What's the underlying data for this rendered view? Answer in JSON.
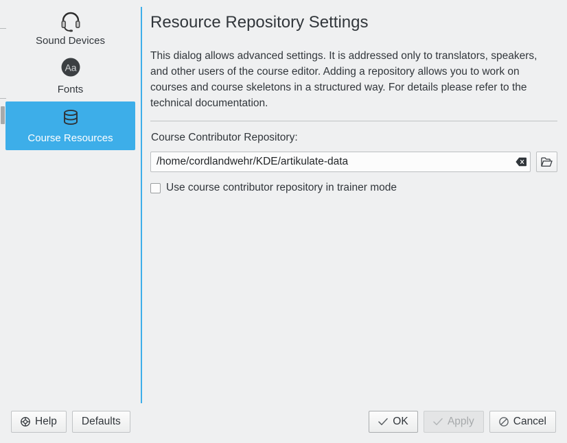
{
  "sidebar": {
    "items": [
      {
        "label": "Sound Devices",
        "icon": "headset-icon",
        "selected": false
      },
      {
        "label": "Fonts",
        "icon": "fonts-aa-icon",
        "selected": false
      },
      {
        "label": "Course Resources",
        "icon": "database-icon",
        "selected": true
      }
    ],
    "selection_color": "#3daee9",
    "divider_color": "#3daee9"
  },
  "page": {
    "title": "Resource Repository Settings",
    "description": "This dialog allows advanced settings. It is addressed only to translators, speakers, and other users of the course editor. Adding a repository allows you to work on courses and course skeletons in a structured way. For details please refer to the technical documentation.",
    "field_label": "Course Contributor Repository:",
    "path_value": "/home/cordlandwehr/KDE/artikulate-data",
    "path_placeholder": "",
    "clear_icon": "clear-text-icon",
    "browse_icon": "folder-open-icon",
    "checkbox_label": "Use course contributor repository in trainer mode",
    "checkbox_checked": false
  },
  "buttons": {
    "help": {
      "label": "Help",
      "icon": "lifering-help-icon",
      "enabled": true
    },
    "defaults": {
      "label": "Defaults",
      "icon": "",
      "enabled": true
    },
    "ok": {
      "label": "OK",
      "icon": "check-icon",
      "enabled": true,
      "default": true
    },
    "apply": {
      "label": "Apply",
      "icon": "check-icon",
      "enabled": false
    },
    "cancel": {
      "label": "Cancel",
      "icon": "no-entry-icon",
      "enabled": true
    }
  }
}
